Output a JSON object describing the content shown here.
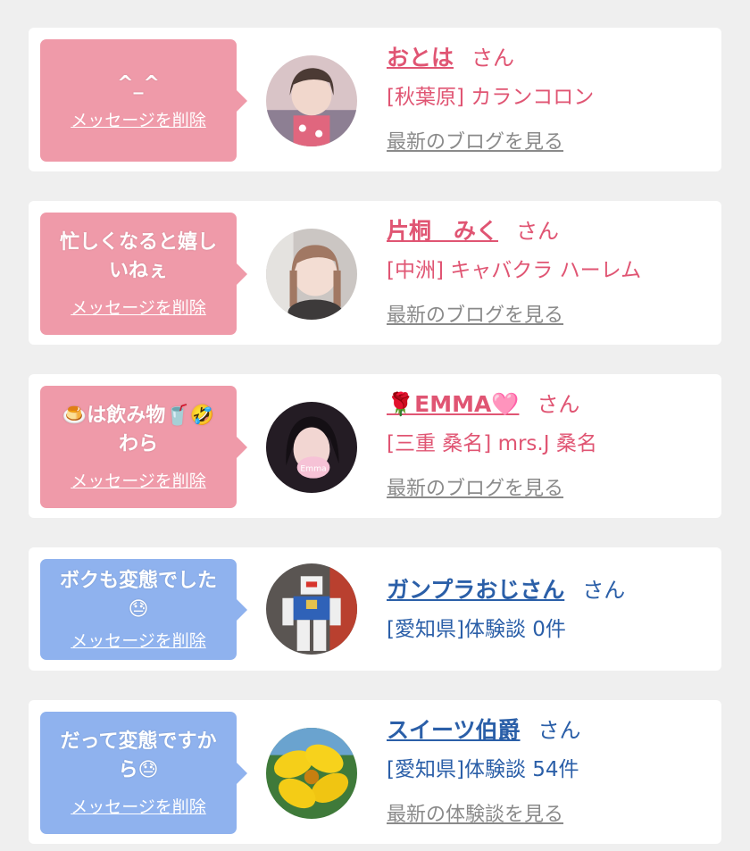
{
  "colors": {
    "pink_bubble": "#ef9aa9",
    "blue_bubble": "#8fb2ee",
    "pink_text": "#e05573",
    "blue_text": "#2b5fa8",
    "gray_link": "#8a8a8a"
  },
  "delete_label": "メッセージを削除",
  "honorific": "さん",
  "cards": [
    {
      "theme": "pink",
      "message_line1": "^_^",
      "message_line2": "",
      "name": "おとは",
      "shop": "[秋葉原] カランコロン",
      "link": "最新のブログを見る",
      "avatar_icon": "girl-photo-icon"
    },
    {
      "theme": "pink",
      "message_line1": "忙しくなると嬉し",
      "message_line2": "いねぇ",
      "name": "片桐　みく",
      "shop": "[中洲] キャバクラ ハーレム",
      "link": "最新のブログを見る",
      "avatar_icon": "girl-photo-icon"
    },
    {
      "theme": "pink",
      "message_line1": "🍮は飲み物🥤🤣",
      "message_line2": "わら",
      "name": "🌹EMMA🩷",
      "shop": "[三重 桑名] mrs.J 桑名",
      "link": "最新のブログを見る",
      "avatar_icon": "girl-photo-icon"
    },
    {
      "theme": "blue",
      "message_line1": "ボクも変態でした",
      "message_line2": "😓",
      "name": "ガンプラおじさん",
      "shop": "[愛知県]体験談 0件",
      "link": "",
      "avatar_icon": "robot-figure-icon"
    },
    {
      "theme": "blue",
      "message_line1": "だって変態ですか",
      "message_line2": "ら😓",
      "name": "スイーツ伯爵",
      "shop": "[愛知県]体験談 54件",
      "link": "最新の体験談を見る",
      "avatar_icon": "yellow-flower-icon"
    }
  ]
}
